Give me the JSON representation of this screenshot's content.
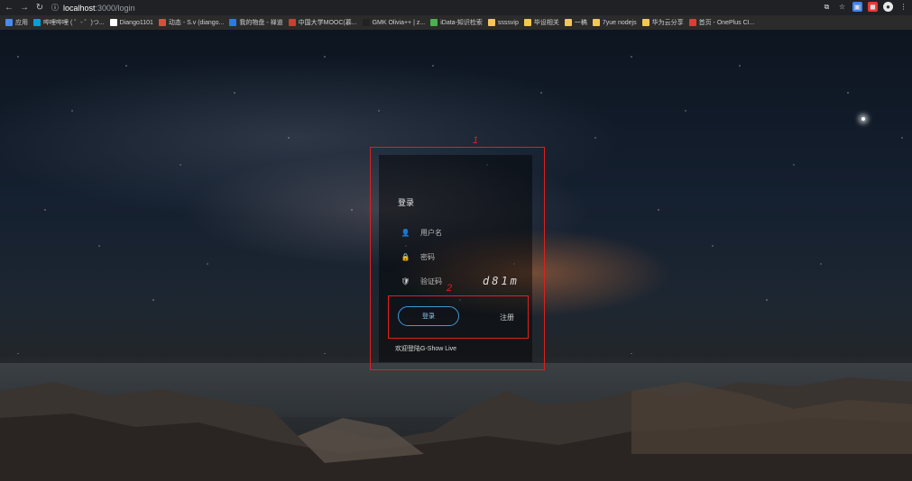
{
  "browser": {
    "url_host": "localhost",
    "url_path": ":3000/login",
    "bookmarks": [
      {
        "label": "应用",
        "color": "#4a8af4"
      },
      {
        "label": "哔哩哔哩 ( ゜- ゜)つ...",
        "color": "#00a1d6"
      },
      {
        "label": "Diango1101",
        "color": "#ffffff"
      },
      {
        "label": "动态 - S.v (diango...",
        "color": "#e24a3b"
      },
      {
        "label": "我的物盘 - 禅道",
        "color": "#2a7ae2"
      },
      {
        "label": "中国大学MOOC(慕...",
        "color": "#d23b2f"
      },
      {
        "label": "GMK Olivia++ | z...",
        "color": "#222222"
      },
      {
        "label": "iData-知识检索",
        "color": "#4caf50"
      },
      {
        "label": "ssssvip",
        "color": "#f2c94c"
      },
      {
        "label": "毕设相关",
        "color": "#f2c94c"
      },
      {
        "label": "一稿",
        "color": "#f2c94c"
      },
      {
        "label": "7yue nodejs",
        "color": "#f2c94c"
      },
      {
        "label": "华为云分享",
        "color": "#f2c94c"
      },
      {
        "label": "首页 - OnePlus CI...",
        "color": "#e53935"
      }
    ]
  },
  "login": {
    "title": "登录",
    "username_placeholder": "用户名",
    "password_placeholder": "密码",
    "captcha_placeholder": "验证码",
    "captcha_text": "d81m",
    "login_button": "登录",
    "register_link": "注册",
    "welcome": "欢迎登陆G-Show Live"
  },
  "annotations": {
    "box1_label": "1",
    "box2_label": "2",
    "color": "#e0201c"
  }
}
